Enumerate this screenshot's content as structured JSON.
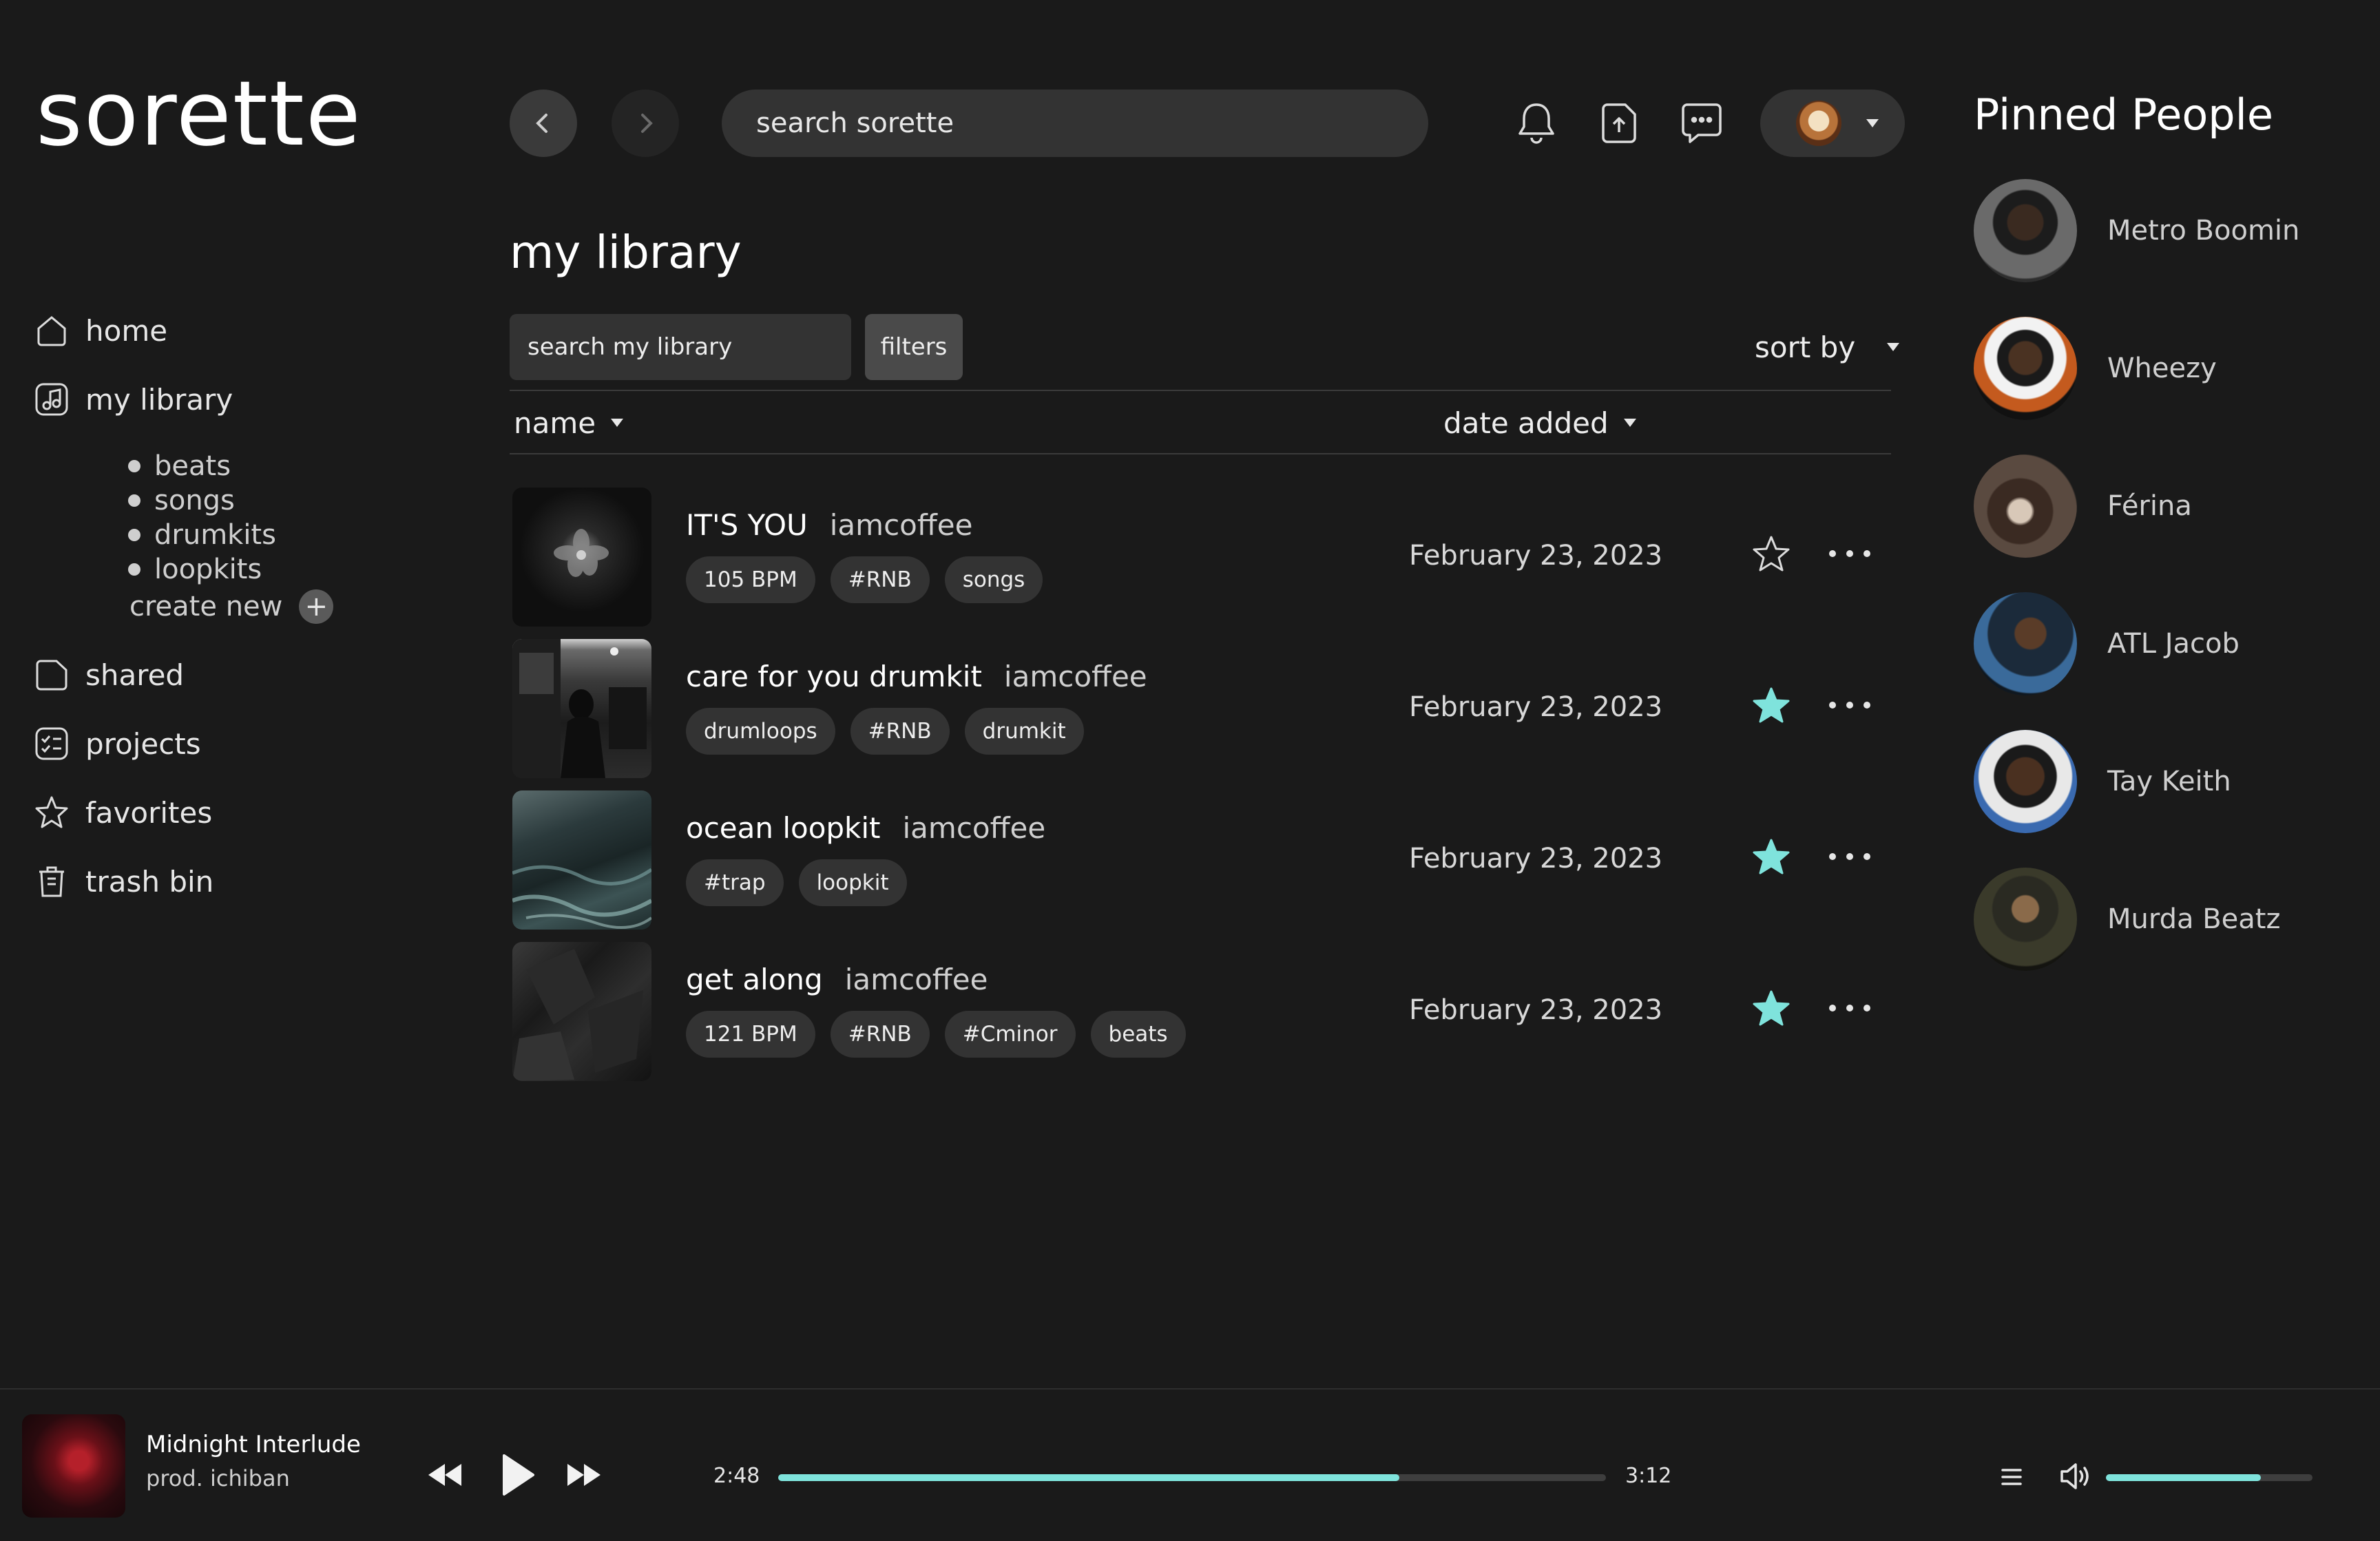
{
  "app": {
    "logo": "sorette"
  },
  "sidebar": {
    "items": [
      {
        "label": "home",
        "icon": "home-icon"
      },
      {
        "label": "my library",
        "icon": "music-note-icon"
      },
      {
        "label": "shared",
        "icon": "folder-icon"
      },
      {
        "label": "projects",
        "icon": "checklist-icon"
      },
      {
        "label": "favorites",
        "icon": "star-icon"
      },
      {
        "label": "trash bin",
        "icon": "trash-icon"
      }
    ],
    "sub_items": [
      "beats",
      "songs",
      "drumkits",
      "loopkits"
    ],
    "create_new": "create new"
  },
  "header": {
    "search_placeholder": "search sorette",
    "icons": [
      "bell-icon",
      "upload-icon",
      "chat-icon"
    ]
  },
  "main": {
    "title": "my library",
    "search_placeholder": "search my library",
    "filters_label": "filters",
    "sort_label": "sort by",
    "columns": {
      "name": "name",
      "date": "date added"
    },
    "items": [
      {
        "title": "IT'S YOU",
        "author": "iamcoffee",
        "tags": [
          "105 BPM",
          "#RNB",
          "songs"
        ],
        "date": "February 23, 2023",
        "favorited": false
      },
      {
        "title": "care for you drumkit",
        "author": "iamcoffee",
        "tags": [
          "drumloops",
          "#RNB",
          "drumkit"
        ],
        "date": "February 23, 2023",
        "favorited": true
      },
      {
        "title": "ocean loopkit",
        "author": "iamcoffee",
        "tags": [
          "#trap",
          "loopkit"
        ],
        "date": "February 23, 2023",
        "favorited": true
      },
      {
        "title": "get along",
        "author": "iamcoffee",
        "tags": [
          "121 BPM",
          "#RNB",
          "#Cminor",
          "beats"
        ],
        "date": "February 23, 2023",
        "favorited": true
      }
    ]
  },
  "pinned": {
    "title": "Pinned People",
    "people": [
      "Metro Boomin",
      "Wheezy",
      "Férina",
      "ATL Jacob",
      "Tay Keith",
      "Murda Beatz"
    ]
  },
  "player": {
    "title": "Midnight Interlude",
    "subtitle": "prod. ichiban",
    "elapsed": "2:48",
    "duration": "3:12",
    "progress": 0.75,
    "volume": 0.75
  },
  "colors": {
    "accent": "#7fe3dc",
    "background": "#1a1a1a",
    "surface": "#333333"
  }
}
